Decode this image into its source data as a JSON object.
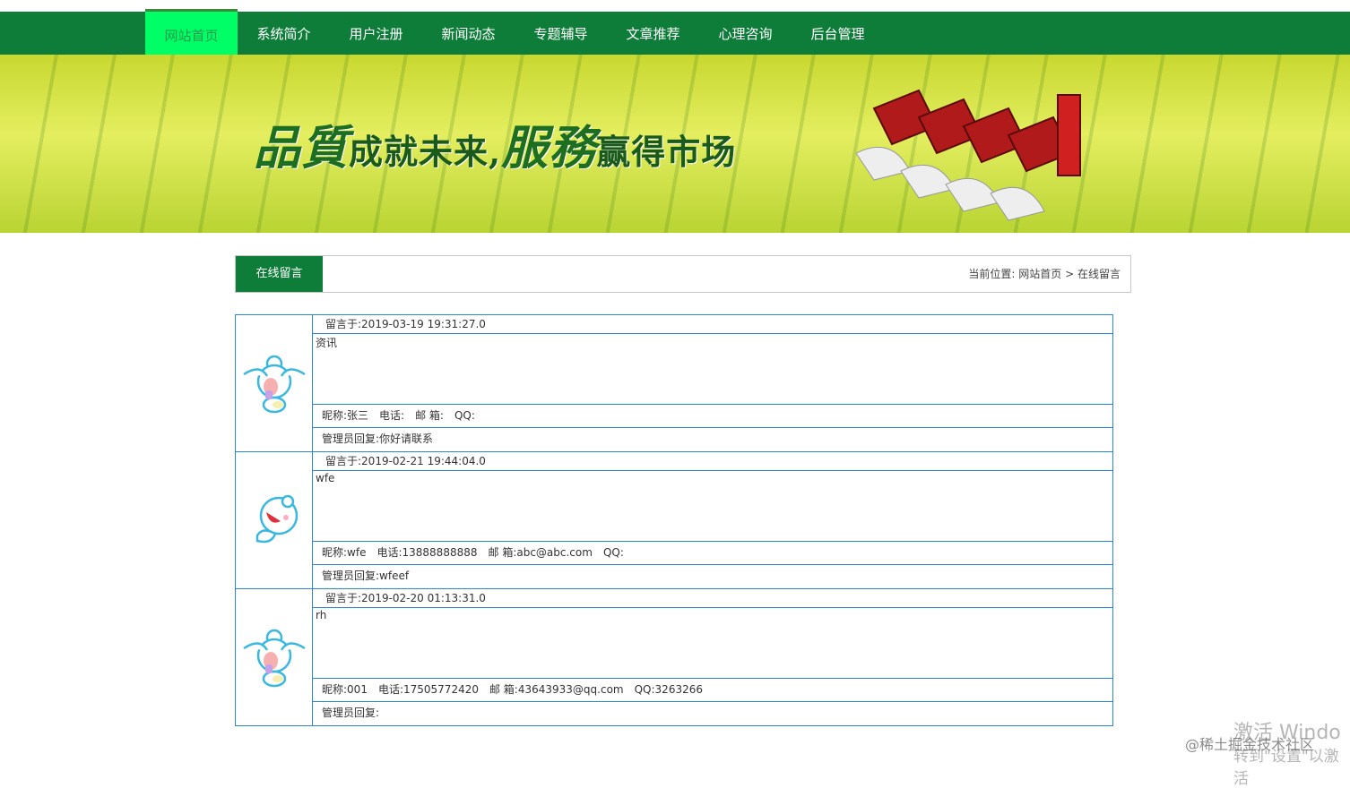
{
  "nav": {
    "items": [
      "网站首页",
      "系统简介",
      "用户注册",
      "新闻动态",
      "专题辅导",
      "文章推荐",
      "心理咨询",
      "后台管理"
    ],
    "active": 0
  },
  "banner": {
    "slogan_a": "品質",
    "slogan_b": "成就未来,",
    "slogan_c": "服務",
    "slogan_d": "赢得市场"
  },
  "section": {
    "title": "在线留言",
    "breadcrumb_label": "当前位置:",
    "breadcrumb_home": "网站首页",
    "breadcrumb_sep": ">",
    "breadcrumb_current": "在线留言"
  },
  "messages": [
    {
      "date": "留言于:2019-03-19 19:31:27.0",
      "body": "资讯",
      "nick": "昵称:张三",
      "phone": "电话:",
      "email": "邮 箱:",
      "qq": "QQ:",
      "reply": "管理员回复:你好请联系",
      "avatar": "crying-cartoon"
    },
    {
      "date": "留言于:2019-02-21 19:44:04.0",
      "body": "wfe",
      "nick": "昵称:wfe",
      "phone": "电话:13888888888",
      "email": "邮 箱:abc@abc.com",
      "qq": "QQ:",
      "reply": "管理员回复:wfeef",
      "avatar": "laughing-cartoon"
    },
    {
      "date": "留言于:2019-02-20 01:13:31.0",
      "body": "rh",
      "nick": "昵称:001",
      "phone": "电话:17505772420",
      "email": "邮 箱:43643933@qq.com",
      "qq": "QQ:3263266",
      "reply": "管理员回复:",
      "avatar": "crying-cartoon"
    }
  ],
  "watermark": {
    "activate": "激活 Windo",
    "goto": "转到\"设置\"以激活",
    "site": "@稀土掘金技术社区"
  }
}
